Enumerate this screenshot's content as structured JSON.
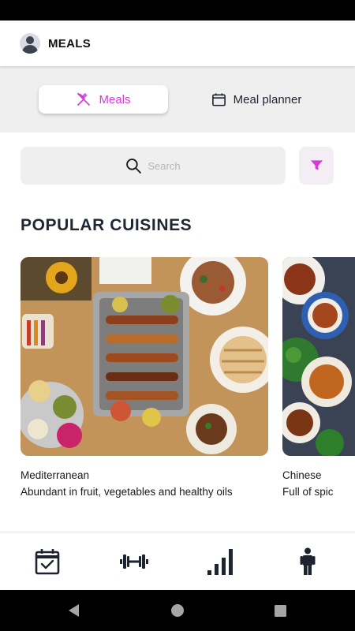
{
  "header": {
    "title": "MEALS",
    "avatar_icon": "user-avatar-icon"
  },
  "tabs": [
    {
      "label": "Meals",
      "icon": "fork-knife-icon",
      "active": true
    },
    {
      "label": "Meal planner",
      "icon": "calendar-icon",
      "active": false
    }
  ],
  "search": {
    "placeholder": "Search",
    "filter_icon": "filter-icon"
  },
  "section": {
    "title": "POPULAR CUISINES"
  },
  "cuisines": [
    {
      "name": "Mediterranean",
      "description": "Abundant in fruit, vegetables and healthy oils"
    },
    {
      "name": "Chinese",
      "description": "Full of spic"
    }
  ],
  "bottom_nav": [
    {
      "icon": "calendar-check-icon",
      "active": true
    },
    {
      "icon": "dumbbell-icon",
      "active": false
    },
    {
      "icon": "bar-chart-icon",
      "active": false
    },
    {
      "icon": "person-icon",
      "active": false
    }
  ],
  "colors": {
    "accent": "#d63bd6",
    "dark": "#1d2430",
    "tab_strip": "#efefef"
  }
}
